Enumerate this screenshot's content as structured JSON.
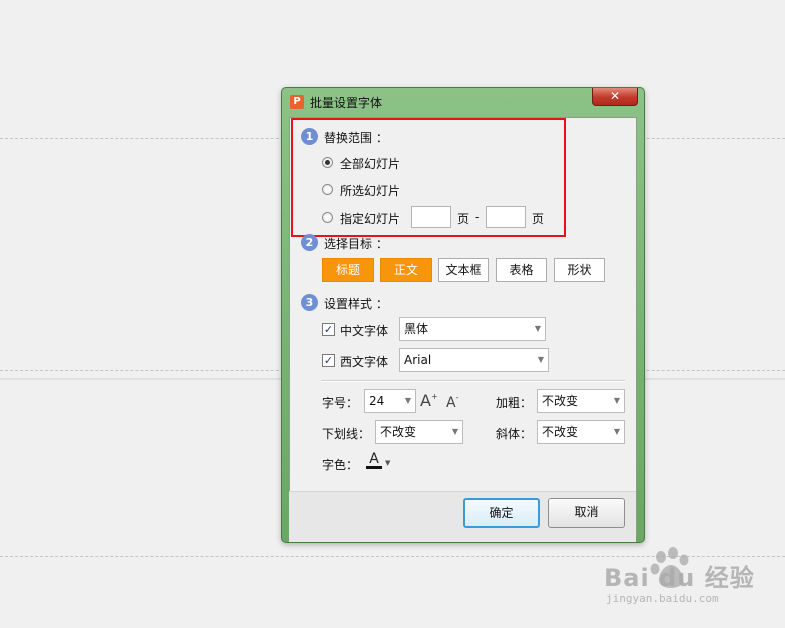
{
  "dialog": {
    "title": "批量设置字体",
    "app_icon_letter": "P",
    "close_symbol": "✕"
  },
  "section1": {
    "number": "1",
    "title": "替换范围 ：",
    "options": [
      {
        "label": "全部幻灯片",
        "selected": true
      },
      {
        "label": "所选幻灯片",
        "selected": false
      },
      {
        "label": "指定幻灯片",
        "selected": false
      }
    ],
    "page_from": "",
    "page_unit_1": "页",
    "dash": "-",
    "page_to": "",
    "page_unit_2": "页"
  },
  "section2": {
    "number": "2",
    "title": "选择目标 ：",
    "buttons": [
      {
        "label": "标题",
        "active": true
      },
      {
        "label": "正文",
        "active": true
      },
      {
        "label": "文本框",
        "active": false
      },
      {
        "label": "表格",
        "active": false
      },
      {
        "label": "形状",
        "active": false
      }
    ]
  },
  "section3": {
    "number": "3",
    "title": "设置样式 ：",
    "chinese_font": {
      "label": "中文字体",
      "checked": true,
      "value": "黑体"
    },
    "western_font": {
      "label": "西文字体",
      "checked": true,
      "value": "Arial"
    },
    "font_size": {
      "label": "字号：",
      "value": "24"
    },
    "bold": {
      "label": "加粗：",
      "value": "不改变"
    },
    "underline": {
      "label": "下划线：",
      "value": "不改变"
    },
    "italic": {
      "label": "斜体：",
      "value": "不改变"
    },
    "color": {
      "label": "字色：",
      "swatch": "#111111"
    },
    "grow_icon": "A",
    "shrink_icon": "A",
    "grow_sup": "+",
    "shrink_sup": "-"
  },
  "actions": {
    "ok": "确定",
    "cancel": "取消"
  },
  "watermark": {
    "brand": "Bai du 经验",
    "url": "jingyan.baidu.com"
  },
  "colors": {
    "dialog_frame": "#7fb879",
    "highlight": "#e0161b",
    "accent_orange": "#f7960a",
    "section_badge": "#6f8fd2",
    "primary_focus": "#3c9ad6"
  }
}
